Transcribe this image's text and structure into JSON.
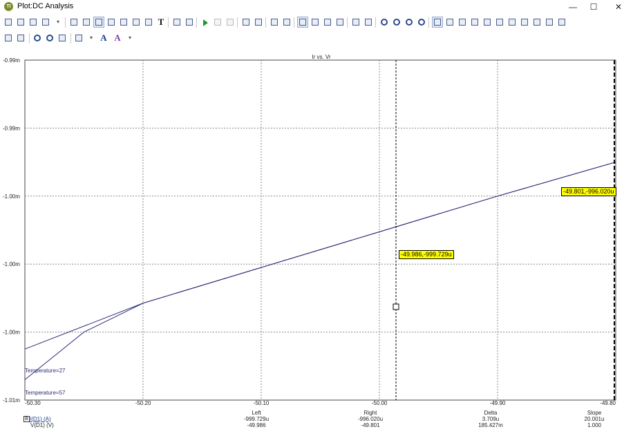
{
  "window": {
    "title": "Plot:DC Analysis",
    "icon": "tina-app-icon",
    "minimize": "—",
    "maximize": "☐",
    "close": "✕"
  },
  "toolbar1": [
    "print-icon",
    "pointer-icon",
    "pan-hand-icon",
    "bookmark-icon",
    "dropdown-arrow-icon",
    "window-icon",
    "copy-window-icon",
    "plot-view-icon",
    "plot-view-2-icon",
    "plot-view-3-icon",
    "plot-view-4-icon",
    "plot-view-5-icon",
    "text-tool",
    "properties-icon",
    "export-icon",
    "run-icon",
    "stop-icon",
    "pause-icon",
    "auto-scale-icon",
    "fit-icon",
    "box-icon",
    "grid-icon",
    "layout-1-icon",
    "layout-2-icon",
    "layout-3-icon",
    "layout-4-icon",
    "split-h-icon",
    "split-v-icon",
    "zoom-1-icon",
    "zoom-2-icon",
    "zoom-3-icon",
    "zoom-4-icon",
    "cursor-1-icon",
    "cursor-2-icon",
    "cursor-3-icon",
    "cursor-4-icon",
    "cursor-5-icon",
    "cursor-6-icon",
    "cursor-7-icon",
    "cursor-8-icon",
    "cursor-9-icon",
    "cursor-10-icon",
    "cursor-11-icon"
  ],
  "toolbar2": {
    "text_A": "A",
    "text_A2": "A"
  },
  "plot": {
    "title": "Ir vs. Vr",
    "y_tick_labels": [
      "-0.99m",
      "-0.99m",
      "-1.00m",
      "-1.00m",
      "-1.00m",
      "-1.01m"
    ],
    "x_tick_labels": [
      "-50.30",
      "-50.20",
      "-50.10",
      "-50.00",
      "-49.90",
      "-49.80"
    ],
    "line_color": "#2b2b78",
    "curve_labels": [
      "Temperature=27",
      "Temperature=57"
    ],
    "cursor_a": "-49.986,-999.729u",
    "cursor_b": "-49.801,-996.020u"
  },
  "chart_data": {
    "type": "line",
    "title": "Ir vs. Vr",
    "xlim": [
      -50.3,
      -49.8
    ],
    "ylim": [
      -1.01,
      -0.99
    ],
    "series": [
      {
        "name": "Temperature=27",
        "x": [
          -50.3,
          -50.2,
          -50.1,
          -50.0,
          -49.9,
          -49.8
        ],
        "y": [
          -1.007,
          -1.0043,
          -1.0022,
          -1.0001,
          -0.998,
          -0.996
        ]
      },
      {
        "name": "Temperature=57",
        "x": [
          -50.3,
          -50.25,
          -50.2,
          -50.1,
          -50.0,
          -49.9,
          -49.8
        ],
        "y": [
          -1.0088,
          -1.006,
          -1.0043,
          -1.0022,
          -1.0001,
          -0.998,
          -0.996
        ]
      }
    ]
  },
  "readout": {
    "left": {
      "header": "Left",
      "ir": "-999.729u",
      "vr": "-49.986"
    },
    "right": {
      "header": "Right",
      "ir": "-996.020u",
      "vr": "-49.801"
    },
    "delta": {
      "header": "Delta",
      "ir": "3.709u",
      "vr": "185.427m"
    },
    "slope": {
      "header": "Slope",
      "ir": "20.001u",
      "vr": "1.000"
    },
    "signal_1": "I(D1) (A)",
    "signal_2": "V(D1) (V)",
    "signal_box": "B"
  }
}
